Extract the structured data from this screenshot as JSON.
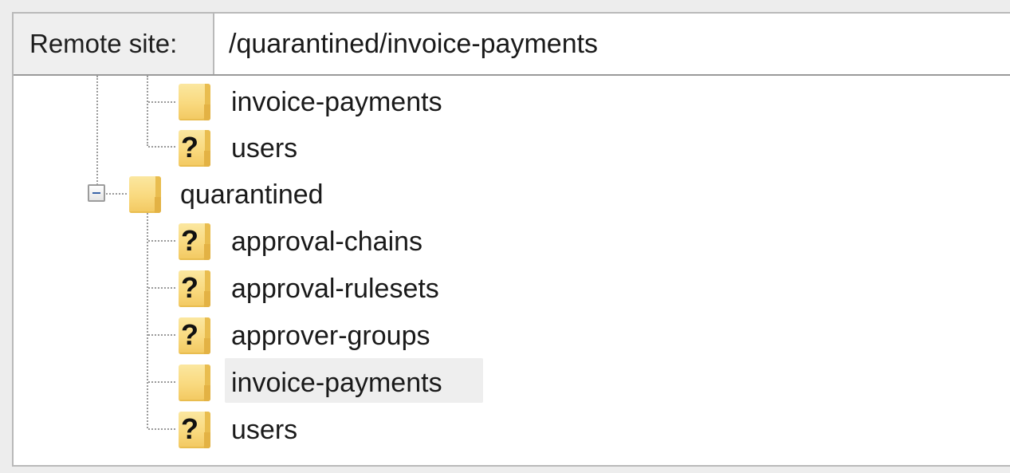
{
  "header": {
    "site_label": "Remote site:",
    "path_value": "/quarantined/invoice-payments"
  },
  "tree": {
    "parent_children": [
      {
        "label": "invoice-payments",
        "icon": "folder-icon"
      },
      {
        "label": "users",
        "icon": "unknown-folder-icon"
      }
    ],
    "quarantined": {
      "label": "quarantined",
      "icon": "folder-icon",
      "expanded": true,
      "children": [
        {
          "label": "approval-chains",
          "icon": "unknown-folder-icon"
        },
        {
          "label": "approval-rulesets",
          "icon": "unknown-folder-icon"
        },
        {
          "label": "approver-groups",
          "icon": "unknown-folder-icon"
        },
        {
          "label": "invoice-payments",
          "icon": "folder-icon",
          "selected": true
        },
        {
          "label": "users",
          "icon": "unknown-folder-icon"
        }
      ]
    },
    "unknown_glyph": "?"
  },
  "colors": {
    "folder": "#f9d97e",
    "selection": "#eeeeee",
    "connector": "#9a9a9a"
  }
}
